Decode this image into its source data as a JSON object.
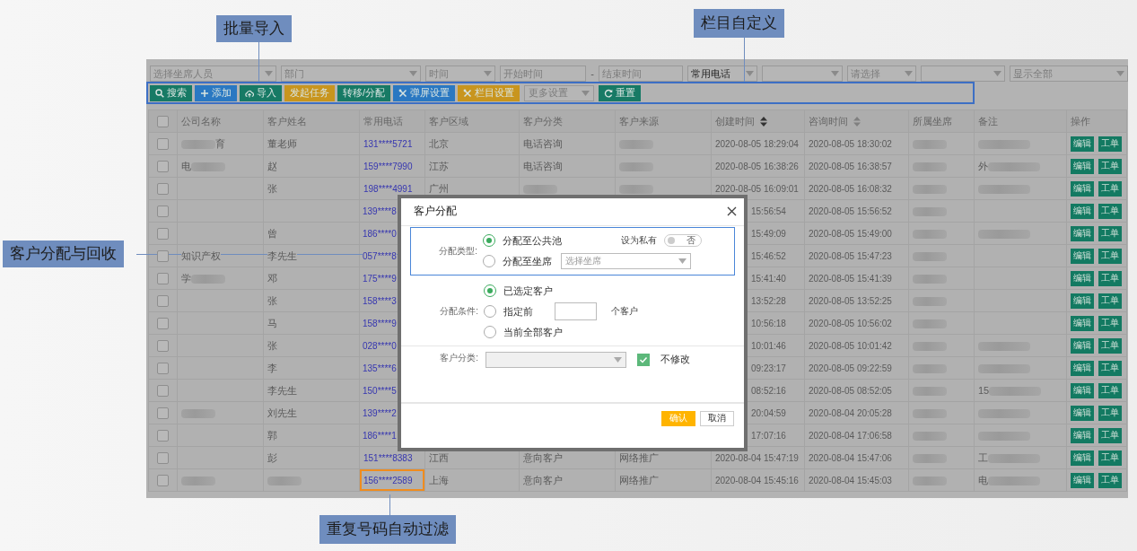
{
  "callouts": [
    {
      "text": "批量导入"
    },
    {
      "text": "栏目自定义"
    },
    {
      "text": "客户分配与回收"
    },
    {
      "text": "重复号码自动过滤"
    }
  ],
  "filters": [
    {
      "kind": "dropdown",
      "placeholder": "选择坐席人员"
    },
    {
      "kind": "dropdown",
      "placeholder": "部门"
    },
    {
      "kind": "dropdown",
      "placeholder": "时间"
    },
    {
      "kind": "input",
      "placeholder": "开始时间"
    },
    {
      "kind": "separator",
      "text": "-"
    },
    {
      "kind": "input",
      "placeholder": "结束时间"
    },
    {
      "kind": "dropdown",
      "value": "常用电话"
    },
    {
      "kind": "dropdown"
    },
    {
      "kind": "dropdown",
      "placeholder": "请选择"
    },
    {
      "kind": "dropdown"
    },
    {
      "kind": "dropdown",
      "placeholder": "显示全部"
    }
  ],
  "toolbar": [
    {
      "kind": "button",
      "label": "搜索",
      "color": "#177a65"
    },
    {
      "kind": "button",
      "label": "添加",
      "color": "#2a78c2"
    },
    {
      "kind": "button",
      "label": "导入",
      "color": "#177a65"
    },
    {
      "kind": "button",
      "label": "发起任务",
      "color": "#c8951e"
    },
    {
      "kind": "button",
      "label": "转移/分配",
      "color": "#177a65"
    },
    {
      "kind": "button",
      "label": "弹屏设置",
      "color": "#2a78c2"
    },
    {
      "kind": "button",
      "label": "栏目设置",
      "color": "#c8951e"
    },
    {
      "kind": "select",
      "placeholder": "更多设置"
    },
    {
      "kind": "button",
      "label": "重置",
      "color": "#177a65"
    }
  ],
  "table": {
    "select_all": {
      "checked": false
    },
    "columns": [
      {
        "label": "公司名称"
      },
      {
        "label": "客户姓名"
      },
      {
        "label": "常用电话"
      },
      {
        "label": "客户区域"
      },
      {
        "label": "客户分类"
      },
      {
        "label": "客户来源"
      },
      {
        "label": "创建时间",
        "sort_active": true
      },
      {
        "label": "咨询时间",
        "sort_active": false
      },
      {
        "label": "所属坐席"
      },
      {
        "label": "备注"
      },
      {
        "label": "操作"
      }
    ],
    "rows": [
      {
        "checked": false,
        "highlighted": false,
        "company": {
          "kind": "blurred",
          "after": "育"
        },
        "name": "董老师",
        "phone": "131****5721",
        "region": "北京",
        "category": "电话咨询",
        "source": {
          "kind": "blurred"
        },
        "created": "2020-08-05 18:29:04",
        "consulted": "2020-08-05 18:30:02",
        "seat": {
          "kind": "blurred"
        },
        "remark": {
          "kind": "blurred"
        },
        "actions": [
          "编辑",
          "工单"
        ]
      },
      {
        "checked": false,
        "highlighted": false,
        "company": {
          "kind": "blurred",
          "text": "电"
        },
        "name": "赵",
        "phone": "159****7990",
        "region": "江苏",
        "category": "电话咨询",
        "source": {
          "kind": "blurred"
        },
        "created": "2020-08-05 16:38:26",
        "consulted": "2020-08-05 16:38:57",
        "seat": {
          "kind": "blurred"
        },
        "remark": {
          "kind": "blurred",
          "text": "外"
        },
        "actions": [
          "编辑",
          "工单"
        ]
      },
      {
        "checked": false,
        "highlighted": false,
        "name": "张",
        "phone": "198****4991",
        "region": "广州",
        "category": {
          "kind": "blurred"
        },
        "source": {
          "kind": "blurred"
        },
        "created": "2020-08-05 16:09:01",
        "consulted": "2020-08-05 16:08:32",
        "seat": {
          "kind": "blurred"
        },
        "remark": {
          "kind": "blurred"
        },
        "actions": [
          "编辑",
          "工单"
        ]
      },
      {
        "checked": false,
        "highlighted": false,
        "phone": "139****8",
        "created": "15:56:54",
        "consulted": "2020-08-05 15:56:52",
        "seat": {
          "kind": "blurred"
        },
        "actions": [
          "编辑",
          "工单"
        ]
      },
      {
        "checked": false,
        "highlighted": false,
        "name": "曾",
        "phone": "186****0",
        "created": "15:49:09",
        "consulted": "2020-08-05 15:49:00",
        "seat": {
          "kind": "blurred"
        },
        "remark": {
          "kind": "blurred"
        },
        "actions": [
          "编辑",
          "工单"
        ]
      },
      {
        "checked": false,
        "highlighted": false,
        "company": "知识产权",
        "name": "李先生",
        "phone": "057****8",
        "created": "15:46:52",
        "consulted": "2020-08-05 15:47:23",
        "seat": {
          "kind": "blurred"
        },
        "actions": [
          "编辑",
          "工单"
        ]
      },
      {
        "checked": false,
        "highlighted": false,
        "company": {
          "kind": "blurred",
          "text": "学"
        },
        "name": "邓",
        "phone": "175****9",
        "created": "15:41:40",
        "consulted": "2020-08-05 15:41:39",
        "seat": {
          "kind": "blurred"
        },
        "actions": [
          "编辑",
          "工单"
        ]
      },
      {
        "checked": false,
        "highlighted": false,
        "name": "张",
        "phone": "158****3",
        "created": "13:52:28",
        "consulted": "2020-08-05 13:52:25",
        "seat": {
          "kind": "blurred"
        },
        "actions": [
          "编辑",
          "工单"
        ]
      },
      {
        "checked": false,
        "highlighted": false,
        "name": "马",
        "phone": "158****9",
        "created": "10:56:18",
        "consulted": "2020-08-05 10:56:02",
        "seat": {
          "kind": "blurred"
        },
        "actions": [
          "编辑",
          "工单"
        ]
      },
      {
        "checked": false,
        "highlighted": false,
        "name": "张",
        "phone": "028****0",
        "created": "10:01:46",
        "consulted": "2020-08-05 10:01:42",
        "seat": {
          "kind": "blurred"
        },
        "remark": {
          "kind": "blurred"
        },
        "actions": [
          "编辑",
          "工单"
        ]
      },
      {
        "checked": false,
        "highlighted": false,
        "name": "李",
        "phone": "135****6",
        "created": "09:23:17",
        "consulted": "2020-08-05 09:22:59",
        "seat": {
          "kind": "blurred"
        },
        "remark": {
          "kind": "blurred"
        },
        "actions": [
          "编辑",
          "工单"
        ]
      },
      {
        "checked": false,
        "highlighted": false,
        "name": "李先生",
        "phone": "150****5",
        "created": "08:52:16",
        "consulted": "2020-08-05 08:52:05",
        "seat": {
          "kind": "blurred"
        },
        "remark": {
          "kind": "blurred",
          "text": "15"
        },
        "actions": [
          "编辑",
          "工单"
        ]
      },
      {
        "checked": false,
        "highlighted": false,
        "company": {
          "kind": "blurred"
        },
        "name": "刘先生",
        "phone": "139****2",
        "created": "20:04:59",
        "consulted": "2020-08-04 20:05:28",
        "seat": {
          "kind": "blurred"
        },
        "remark": {
          "kind": "blurred"
        },
        "actions": [
          "编辑",
          "工单"
        ]
      },
      {
        "checked": false,
        "highlighted": false,
        "name": "郭",
        "phone": "186****1",
        "created": "17:07:16",
        "consulted": "2020-08-04 17:06:58",
        "seat": {
          "kind": "blurred"
        },
        "remark": {
          "kind": "blurred"
        },
        "actions": [
          "编辑",
          "工单"
        ]
      },
      {
        "checked": false,
        "highlighted": false,
        "name": "彭",
        "phone": "151****8383",
        "region": "江西",
        "category": "意向客户",
        "source": "网络推广",
        "created": "2020-08-04 15:47:19",
        "consulted": "2020-08-04 15:47:06",
        "seat": {
          "kind": "blurred"
        },
        "remark": {
          "kind": "blurred",
          "text": "工"
        },
        "actions": [
          "编辑",
          "工单"
        ]
      },
      {
        "checked": false,
        "highlighted": true,
        "company": {
          "kind": "blurred"
        },
        "name": {
          "kind": "blurred"
        },
        "phone": "156****2589",
        "region": "上海",
        "category": "意向客户",
        "source": "网络推广",
        "created": "2020-08-04 15:45:16",
        "consulted": "2020-08-04 15:45:03",
        "seat": {
          "kind": "blurred"
        },
        "remark": {
          "kind": "blurred",
          "text": "电"
        },
        "actions": [
          "编辑",
          "工单"
        ]
      }
    ]
  },
  "dialog": {
    "title": "客户分配",
    "allocation_type": {
      "label": "分配类型:",
      "options": [
        {
          "label": "分配至公共池",
          "selected": true
        },
        {
          "label": "分配至坐席",
          "selected": false,
          "select_placeholder": "选择坐席"
        }
      ],
      "private": {
        "label": "设为私有",
        "on": false,
        "state_text": "否"
      }
    },
    "condition": {
      "label": "分配条件:",
      "options": [
        {
          "label": "已选定客户",
          "selected": true
        },
        {
          "label": "指定前",
          "selected": false,
          "suffix": "个客户"
        },
        {
          "label": "当前全部客户",
          "selected": false
        }
      ]
    },
    "category": {
      "label": "客户分类:",
      "keep": {
        "label": "不修改",
        "checked": true
      }
    },
    "buttons": [
      {
        "label": "确认",
        "kind": "primary"
      },
      {
        "label": "取消",
        "kind": "default"
      }
    ]
  }
}
